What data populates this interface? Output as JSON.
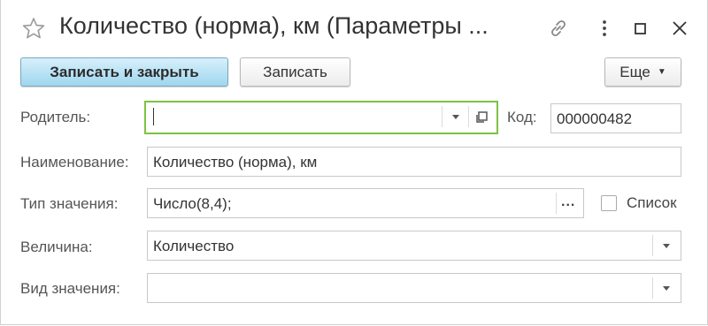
{
  "window": {
    "title": "Количество (норма), км (Параметры ...",
    "icons": [
      "star-icon",
      "link-icon",
      "more-vert-icon",
      "maximize-icon",
      "close-icon"
    ]
  },
  "toolbar": {
    "save_close_label": "Записать и закрыть",
    "save_label": "Записать",
    "more_label": "Еще"
  },
  "form": {
    "parent": {
      "label": "Родитель:",
      "value": ""
    },
    "code": {
      "label": "Код:",
      "value": "000000482"
    },
    "name": {
      "label": "Наименование:",
      "value": "Количество (норма), км"
    },
    "value_type": {
      "label": "Тип значения:",
      "value": "Число(8,4);"
    },
    "list": {
      "label": "Список",
      "checked": false
    },
    "quantity": {
      "label": "Величина:",
      "value": "Количество"
    },
    "value_kind": {
      "label": "Вид значения:",
      "value": ""
    }
  },
  "colors": {
    "primary_button": "#9fd6ee",
    "focus_border": "#7dc242"
  }
}
